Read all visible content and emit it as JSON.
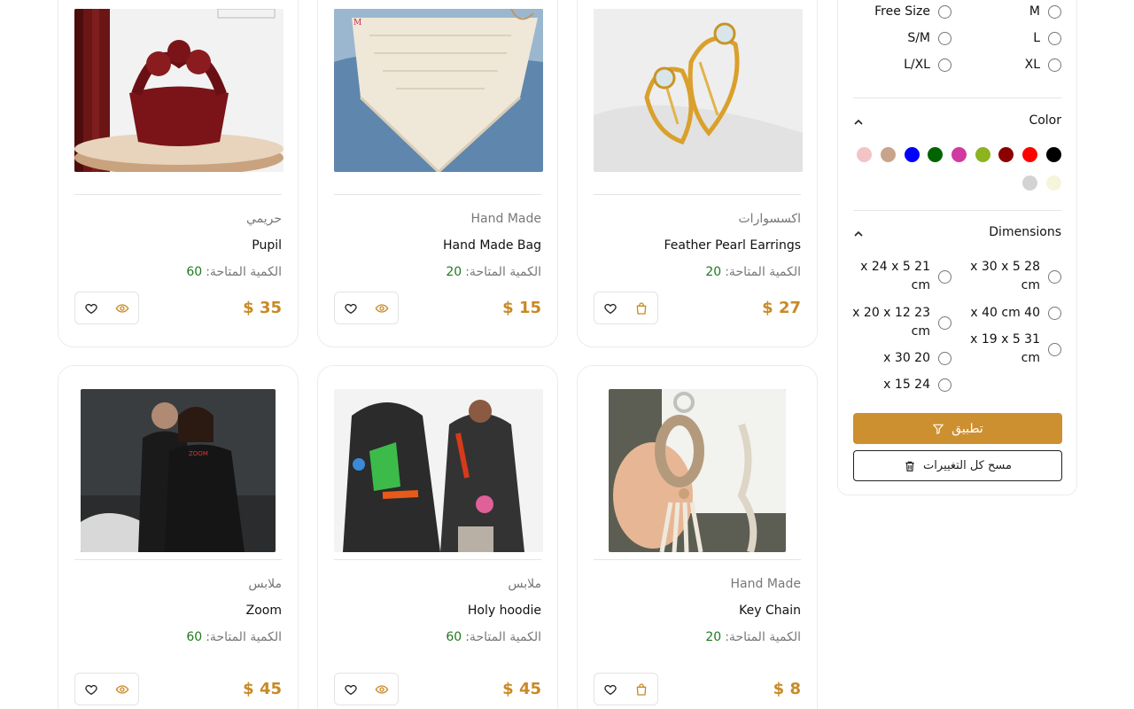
{
  "products": [
    {
      "category": "حريمي",
      "name": "Pupil",
      "qty_label": "الكمية المتاحة:",
      "qty": "60",
      "price": "$ 35",
      "second_icon": "eye-icon"
    },
    {
      "category": "Hand Made",
      "name": "Hand Made Bag",
      "qty_label": "الكمية المتاحة:",
      "qty": "20",
      "price": "$ 15",
      "second_icon": "eye-icon"
    },
    {
      "category": "اكسسوارات",
      "name": "Feather Pearl Earrings",
      "qty_label": "الكمية المتاحة:",
      "qty": "20",
      "price": "$ 27",
      "second_icon": "shopping-bag-icon"
    },
    {
      "category": "ملابس",
      "name": "Zoom",
      "qty_label": "الكمية المتاحة:",
      "qty": "60",
      "price": "$ 45",
      "second_icon": "eye-icon"
    },
    {
      "category": "ملابس",
      "name": "Holy hoodie",
      "qty_label": "الكمية المتاحة:",
      "qty": "60",
      "price": "$ 45",
      "second_icon": "eye-icon"
    },
    {
      "category": "Hand Made",
      "name": "Key Chain",
      "qty_label": "الكمية المتاحة:",
      "qty": "20",
      "price": "$ 8",
      "second_icon": "shopping-bag-icon"
    }
  ],
  "filters": {
    "sizes": [
      "M",
      "Free Size",
      "L",
      "S/M",
      "XL",
      "L/XL"
    ],
    "color": {
      "title": "Color",
      "swatches": [
        "#000000",
        "#ff0000",
        "#8b0000",
        "#8db31f",
        "#d13aa0",
        "#006400",
        "#0000ff",
        "#c8a58a",
        "#f2c4c6",
        "#f5f5dc",
        "#d3d3d3"
      ]
    },
    "dimensions": {
      "title": "Dimensions",
      "options": [
        {
          "line1": "x 30 x 5 28",
          "line2": "cm"
        },
        {
          "line1": "x 24 x 5 21",
          "line2": "cm"
        },
        {
          "line1": "x 40 cm 40",
          "line2": ""
        },
        {
          "line1": "x 20 x 12 23",
          "line2": "cm"
        },
        {
          "line1": "x 19 x 5 31",
          "line2": "cm"
        },
        {
          "line1": "x 30 20",
          "line2": ""
        },
        {
          "line1": "x 15 24",
          "line2": ""
        }
      ]
    },
    "apply_label": "تطبيق",
    "clear_label": "مسح كل التغييرات"
  }
}
